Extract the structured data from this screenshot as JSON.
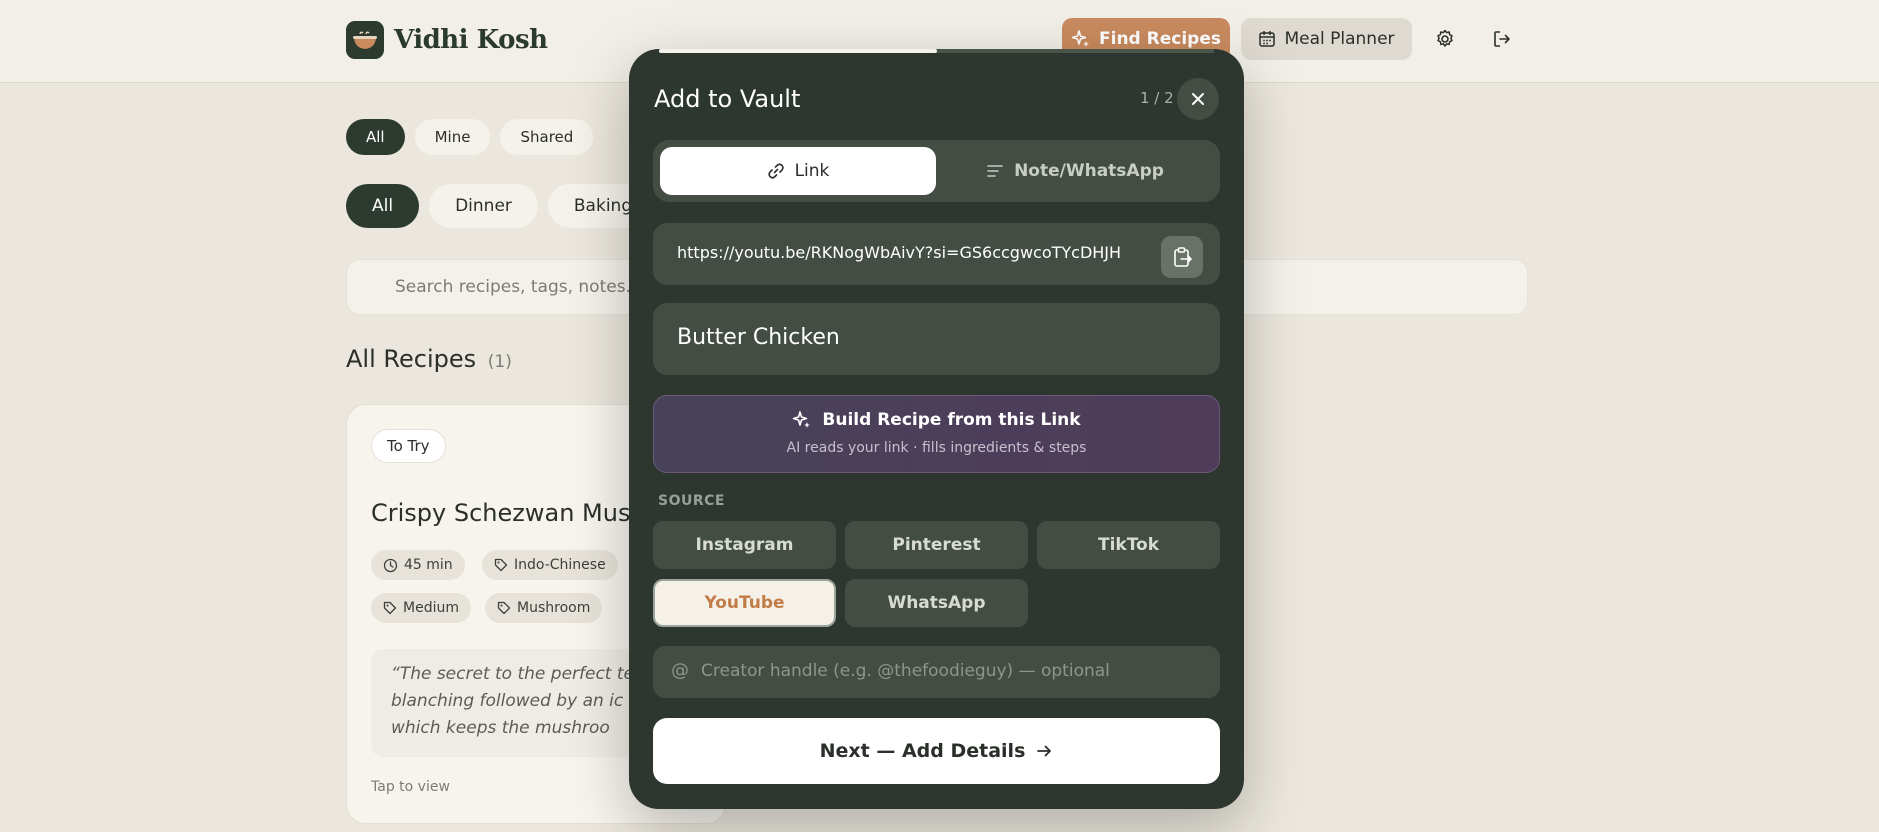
{
  "app": {
    "name": "Vidhi Kosh",
    "find_recipes": "Find Recipes",
    "meal_planner": "Meal Planner"
  },
  "filters": {
    "owner": [
      "All",
      "Mine",
      "Shared"
    ],
    "categories": [
      "All",
      "Dinner",
      "Baking"
    ]
  },
  "search": {
    "placeholder": "Search recipes, tags, notes..."
  },
  "section": {
    "title": "All Recipes",
    "count": "(1)"
  },
  "recipe_card": {
    "status": "To Try",
    "title": "Crispy Schezwan Mushr",
    "time": "45 min",
    "cuisine": "Indo-Chinese",
    "difficulty": "Medium",
    "ingredient": "Mushroom",
    "quote": "“The secret to the perfect text the blanching followed by an ic bath, which keeps the mushroo",
    "tap": "Tap to view"
  },
  "modal": {
    "title": "Add to Vault",
    "step": "1 / 2",
    "progress": 0.5,
    "tabs": [
      "Link",
      "Note/WhatsApp"
    ],
    "url": "https://youtu.be/RKNogWbAivY?si=GS6ccgwcoTYcDHJH",
    "recipe_title": "Butter Chicken",
    "build": {
      "title": "Build Recipe from this Link",
      "subtitle": "AI reads your link · fills ingredients & steps"
    },
    "source_label": "SOURCE",
    "sources": [
      "Instagram",
      "Pinterest",
      "TikTok",
      "YouTube",
      "WhatsApp"
    ],
    "selected_source": "YouTube",
    "handle_placeholder": "Creator handle (e.g. @thefoodieguy) — optional",
    "next": "Next — Add Details"
  },
  "colors": {
    "accent": "#c98a5e",
    "modal_bg": "#2d372f",
    "selected_source_text": "#c27c48"
  }
}
